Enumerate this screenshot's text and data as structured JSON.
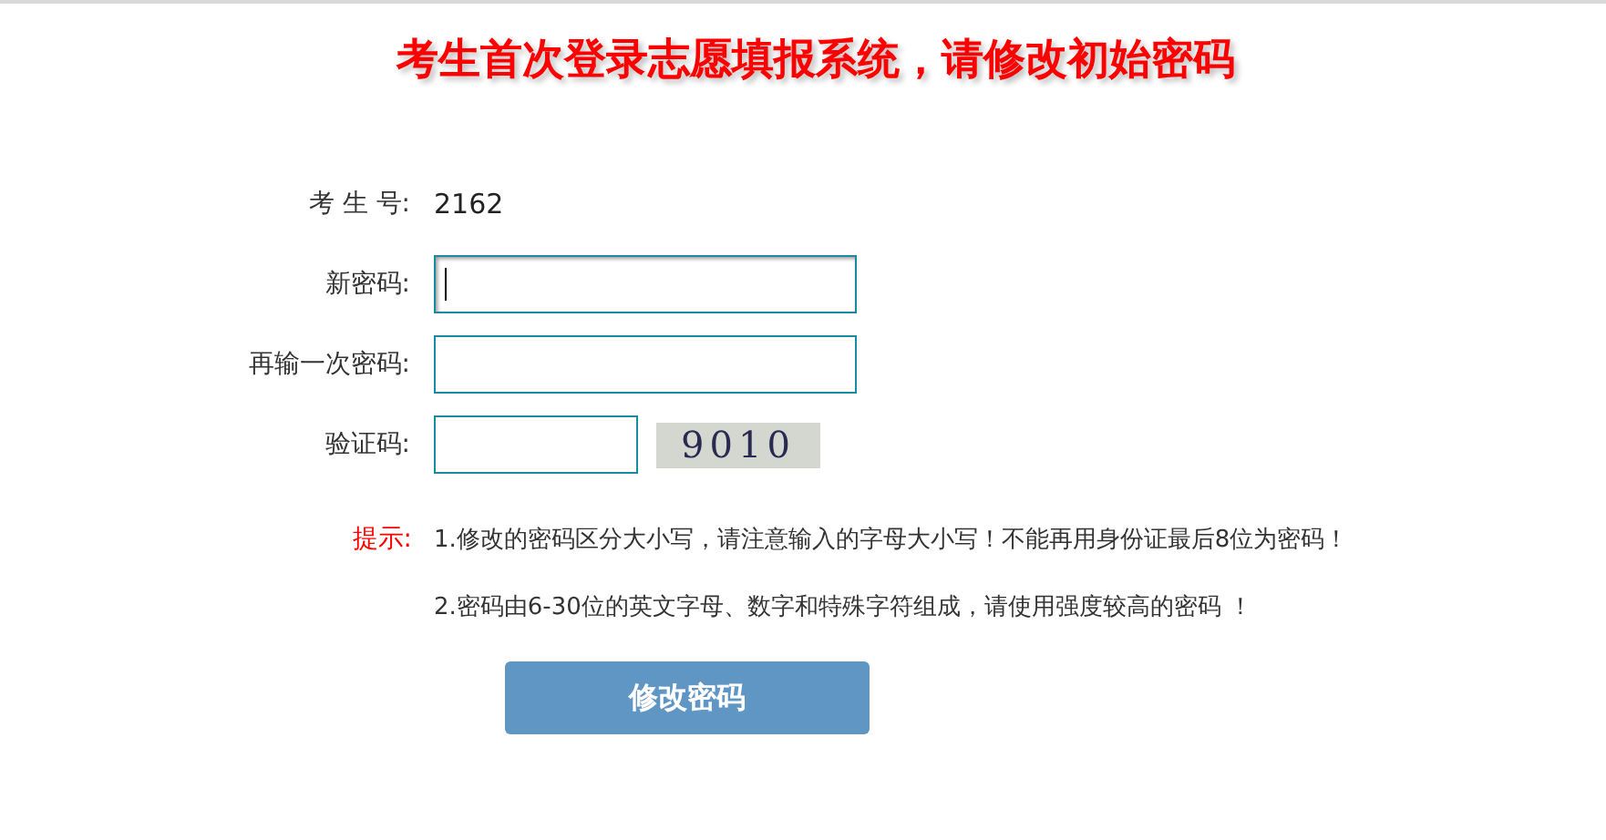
{
  "title": "考生首次登录志愿填报系统，请修改初始密码",
  "fields": [
    {
      "kind": "text",
      "label": "考 生 号:",
      "value": "2162"
    },
    {
      "kind": "input",
      "label": "新密码:",
      "focused": true
    },
    {
      "kind": "input",
      "label": "再输一次密码:",
      "focused": false
    },
    {
      "kind": "captcha",
      "label": "验证码:",
      "captcha": "9010"
    }
  ],
  "hint_label": "提示:",
  "hints": [
    "1.修改的密码区分大小写，请注意输入的字母大小写！不能再用身份证最后8位为密码！",
    "2.密码由6-30位的英文字母、数字和特殊字符组成，请使用强度较高的密码 ！"
  ],
  "submit": "修改密码"
}
